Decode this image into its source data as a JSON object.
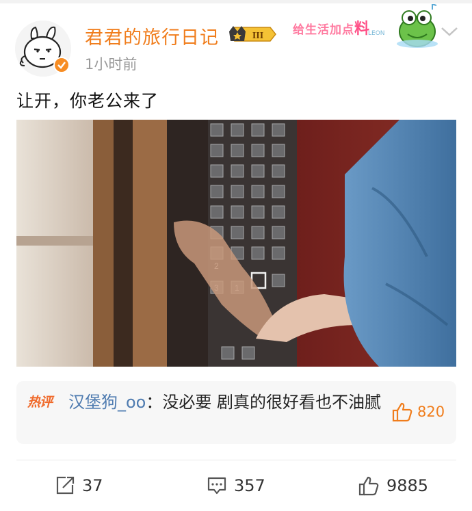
{
  "author": {
    "name": "君君的旅行日记",
    "level_badge": "III",
    "timestamp": "1小时前"
  },
  "brand": {
    "slogan": "给生活加点",
    "slogan_big": "料",
    "sub": "LEON"
  },
  "post": {
    "text": "让开，你老公来了"
  },
  "media": {
    "elevator_numbers": [
      "3",
      "2",
      "1"
    ]
  },
  "hot_comment": {
    "tag": "热评",
    "user": "汉堡狗_oo",
    "separator": "：",
    "text": "没必要 剧真的很好看也不油腻",
    "likes": "820"
  },
  "actions": {
    "reposts": "37",
    "comments": "357",
    "likes": "9885"
  },
  "colors": {
    "accent": "#f07d1c",
    "link": "#4e7bb0",
    "muted": "#999999"
  }
}
